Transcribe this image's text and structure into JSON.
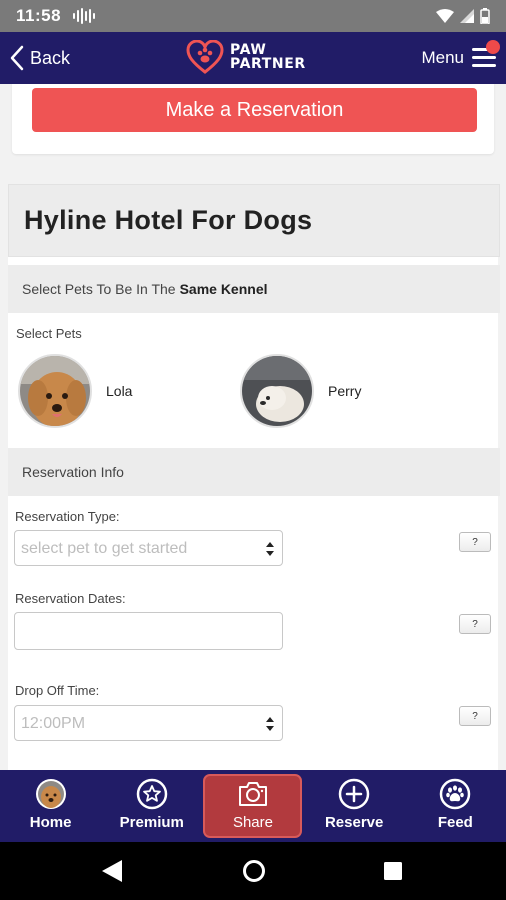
{
  "status_bar": {
    "time": "11:58"
  },
  "header": {
    "back_label": "Back",
    "logo_text": "PAW\nPARTNER",
    "menu_label": "Menu",
    "accent_color": "#211c67",
    "notification_color": "#ee4a4a"
  },
  "reserve_button": {
    "label": "Make a Reservation",
    "color": "#ef5454"
  },
  "hotel": {
    "title": "Hyline Hotel For Dogs"
  },
  "kennel_section": {
    "prefix": "Select Pets To Be In The",
    "bold": "Same Kennel"
  },
  "select_pets": {
    "label": "Select Pets",
    "pets": [
      {
        "name": "Lola"
      },
      {
        "name": "Perry"
      }
    ]
  },
  "reservation_info": {
    "heading": "Reservation Info",
    "type_label": "Reservation Type:",
    "type_value": "select pet to get started",
    "dates_label": "Reservation Dates:",
    "dates_value": "",
    "dropoff_label": "Drop Off Time:",
    "dropoff_value": "12:00PM",
    "help_label": "?"
  },
  "bottom_nav": {
    "items": [
      {
        "label": "Home",
        "icon": "home-avatar-icon"
      },
      {
        "label": "Premium",
        "icon": "star-icon"
      },
      {
        "label": "Share",
        "icon": "camera-icon"
      },
      {
        "label": "Reserve",
        "icon": "plus-circle-icon"
      },
      {
        "label": "Feed",
        "icon": "paw-icon"
      }
    ],
    "active_index": 2
  }
}
